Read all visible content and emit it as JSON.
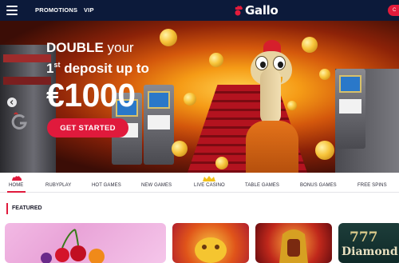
{
  "topbar": {
    "nav": [
      "PROMOTIONS",
      "VIP"
    ],
    "brand": "Gallo",
    "cta_partial": "C"
  },
  "hero": {
    "headline_bold": "DOUBLE",
    "headline_light": "your",
    "line2_prefix": "1",
    "line2_sup": "st",
    "line2_rest": "deposit up to",
    "amount": "€1000",
    "cta": "GET STARTED"
  },
  "categories": [
    {
      "label": "HOME",
      "icon": "rooster-icon",
      "active": true
    },
    {
      "label": "RUBYPLAY"
    },
    {
      "label": "HOT GAMES"
    },
    {
      "label": "NEW GAMES"
    },
    {
      "label": "LIVE CASINO",
      "icon": "crown-icon"
    },
    {
      "label": "TABLE GAMES"
    },
    {
      "label": "BONUS GAMES"
    },
    {
      "label": "FREE SPINS"
    }
  ],
  "featured": {
    "title": "FEATURED",
    "cards": [
      {
        "name": "fruit-slot"
      },
      {
        "name": "piggy-slot"
      },
      {
        "name": "pharaoh-slot"
      },
      {
        "name": "777-diamond-slot",
        "text1": "777",
        "text2": "Diamond"
      }
    ]
  },
  "colors": {
    "navy": "#0c1a3a",
    "accent_red": "#e01a3c"
  }
}
